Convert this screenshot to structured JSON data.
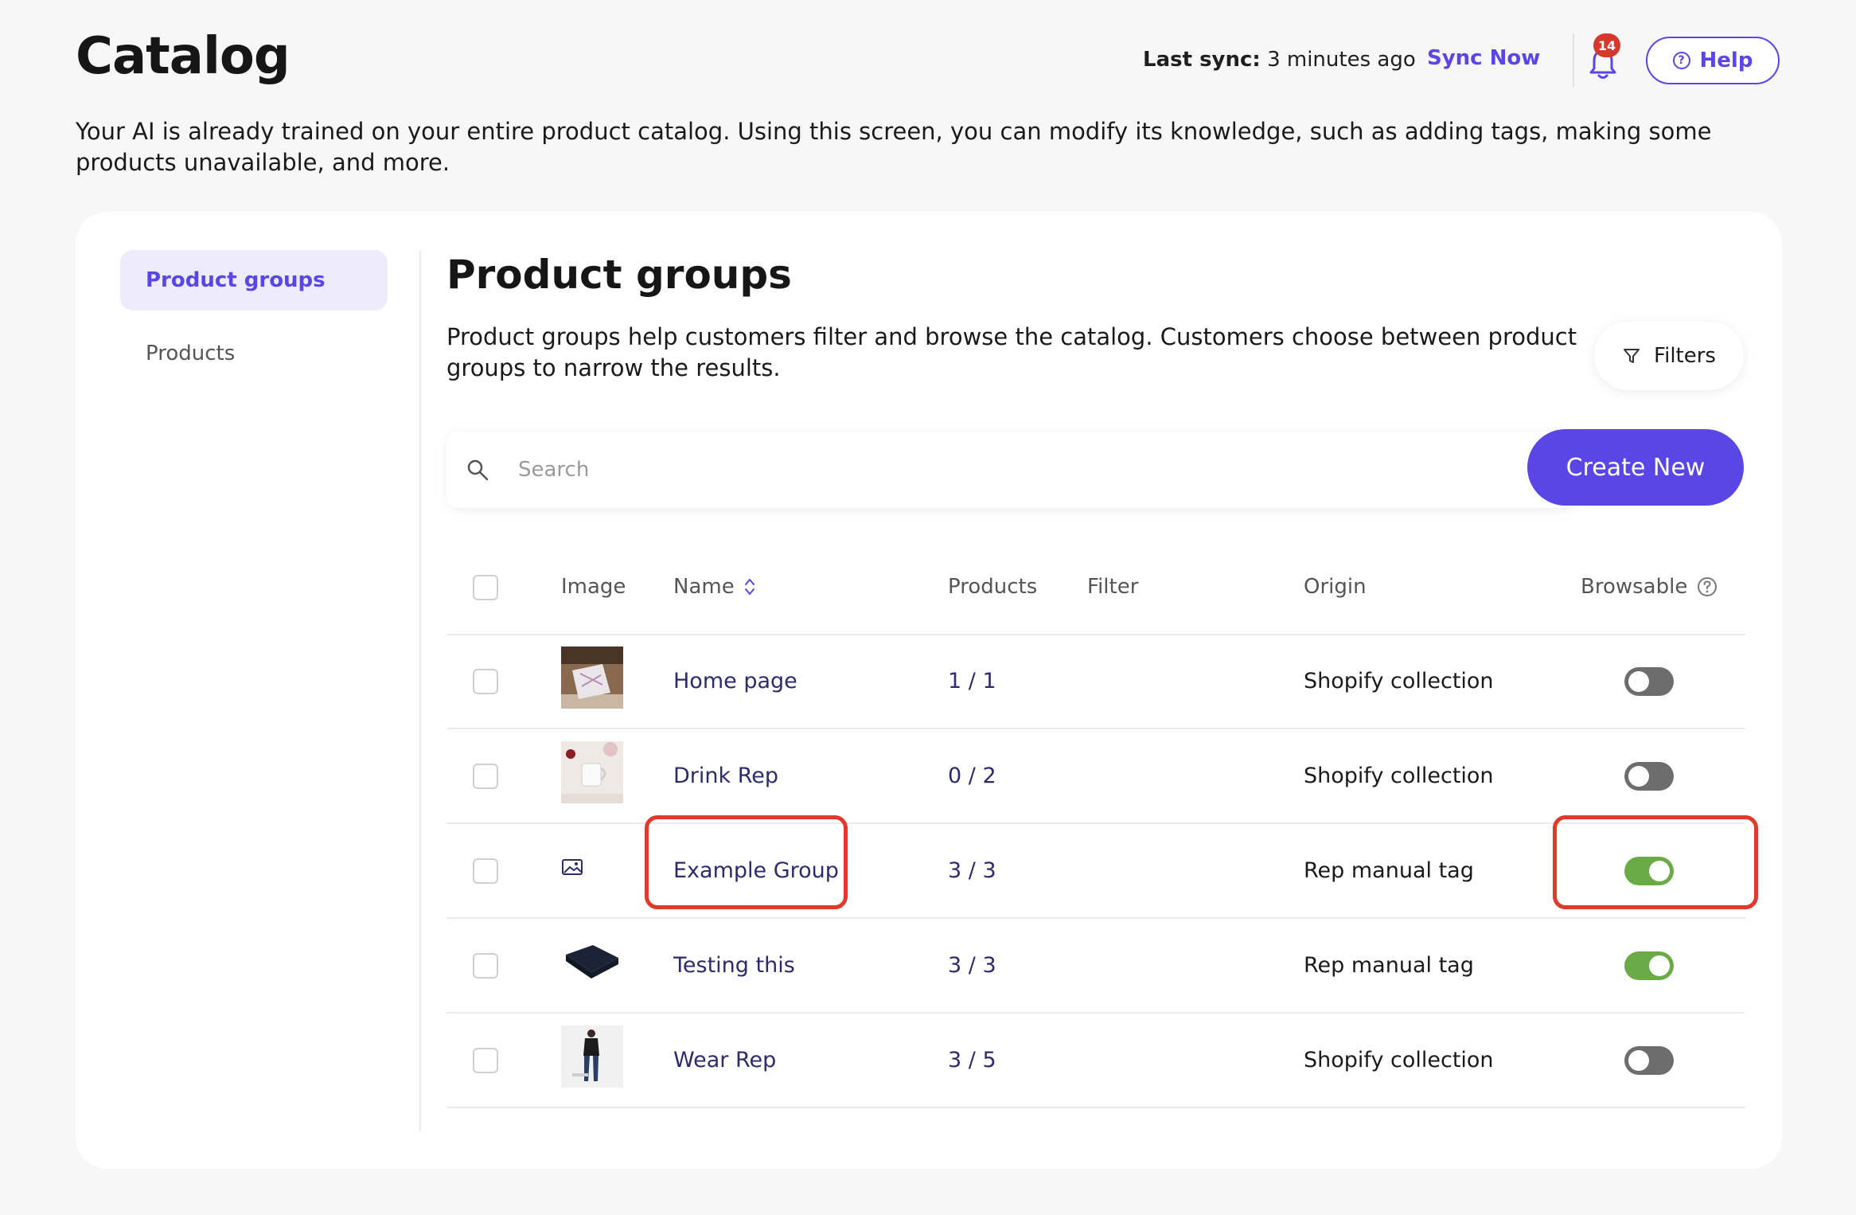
{
  "header": {
    "title": "Catalog",
    "last_sync_label": "Last sync:",
    "last_sync_value": "3 minutes ago",
    "sync_now": "Sync Now",
    "notification_count": "14",
    "help": "Help"
  },
  "intro": "Your AI is already trained on your entire product catalog. Using this screen, you can modify its knowledge, such as adding tags, making some products unavailable, and more.",
  "sidebar": {
    "items": [
      {
        "label": "Product groups",
        "active": true
      },
      {
        "label": "Products",
        "active": false
      }
    ]
  },
  "main": {
    "title": "Product groups",
    "description": "Product groups help customers filter and browse the catalog. Customers choose between product groups to narrow the results.",
    "filters_label": "Filters",
    "search_placeholder": "Search",
    "create_new": "Create New",
    "columns": {
      "image": "Image",
      "name": "Name",
      "products": "Products",
      "filter": "Filter",
      "origin": "Origin",
      "browsable": "Browsable"
    },
    "rows": [
      {
        "name": "Home page",
        "products": "1 / 1",
        "filter": "",
        "origin": "Shopify collection",
        "browsable": false,
        "image": "pillow-photo"
      },
      {
        "name": "Drink Rep",
        "products": "0 / 2",
        "filter": "",
        "origin": "Shopify collection",
        "browsable": false,
        "image": "mug-photo"
      },
      {
        "name": "Example Group",
        "products": "3 / 3",
        "filter": "",
        "origin": "Rep manual tag",
        "browsable": true,
        "image": "image-placeholder-icon"
      },
      {
        "name": "Testing this",
        "products": "3 / 3",
        "filter": "",
        "origin": "Rep manual tag",
        "browsable": true,
        "image": "wallet-photo"
      },
      {
        "name": "Wear Rep",
        "products": "3 / 5",
        "filter": "",
        "origin": "Shopify collection",
        "browsable": false,
        "image": "apparel-photo"
      }
    ]
  },
  "colors": {
    "accent": "#5a45e6",
    "toggle_on": "#6aaa47",
    "toggle_off": "#6d6d6d",
    "highlight": "#e03a2a",
    "badge": "#d4392b"
  }
}
